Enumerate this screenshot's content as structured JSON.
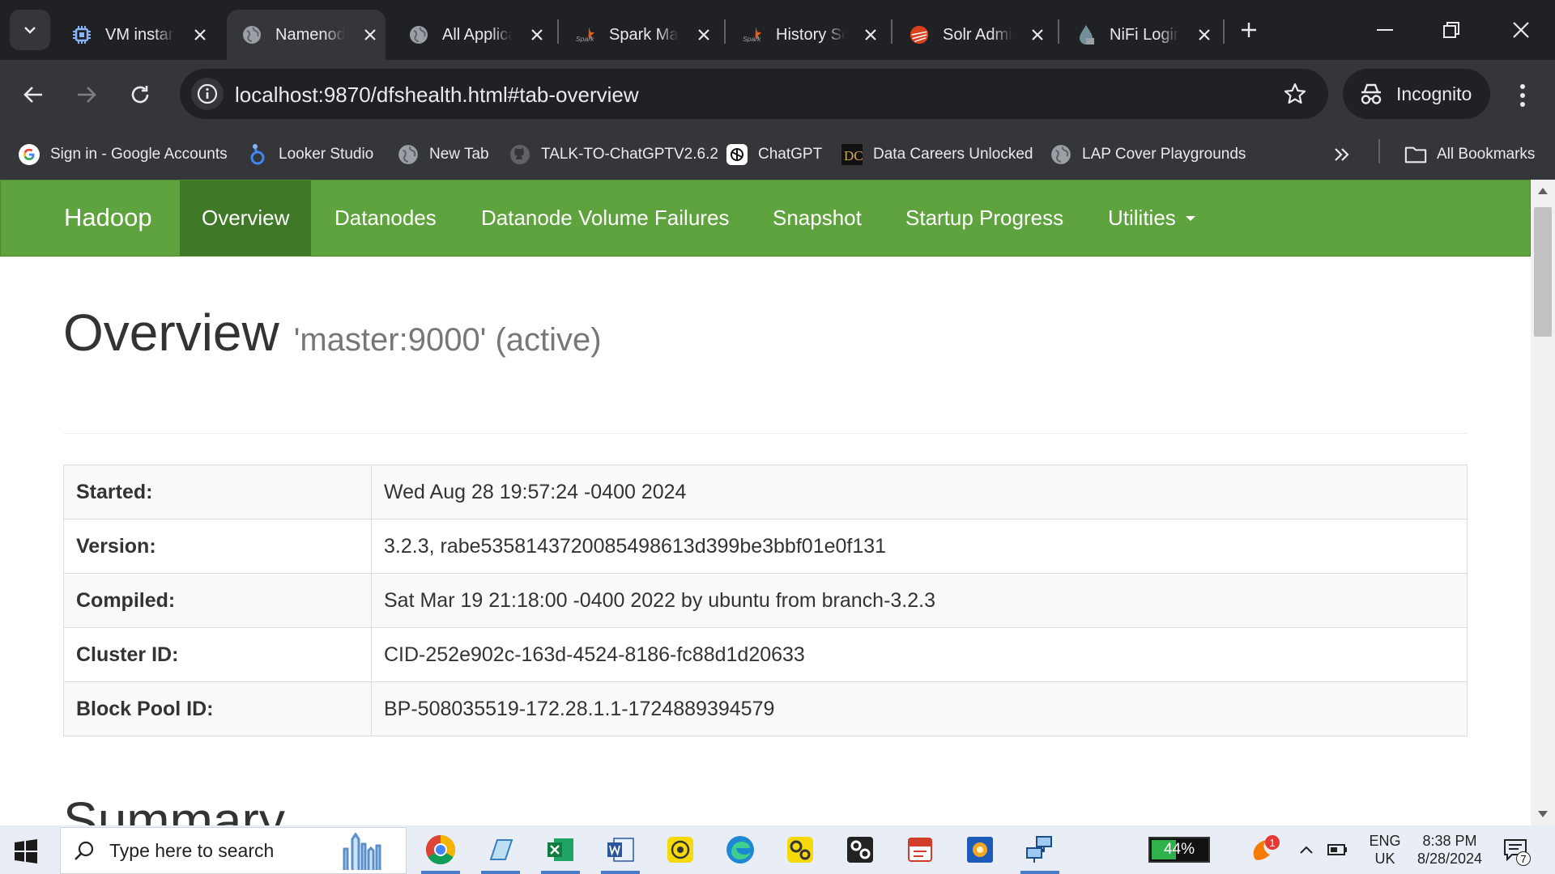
{
  "browser": {
    "tabs": [
      {
        "title": "VM instances",
        "icon": "cpu-chip-icon"
      },
      {
        "title": "Namenode information",
        "icon": "globe-icon"
      },
      {
        "title": "All Applications",
        "icon": "globe-icon"
      },
      {
        "title": "Spark Master",
        "icon": "spark-logo-icon"
      },
      {
        "title": "History Server",
        "icon": "spark-logo-icon"
      },
      {
        "title": "Solr Admin",
        "icon": "solr-logo-icon"
      },
      {
        "title": "NiFi Login",
        "icon": "nifi-drop-icon"
      }
    ],
    "url": "localhost:9870/dfshealth.html#tab-overview",
    "incognito_label": "Incognito",
    "bookmarks": [
      {
        "label": "Sign in - Google Accounts",
        "icon": "google-g-icon"
      },
      {
        "label": "Looker Studio",
        "icon": "looker-icon"
      },
      {
        "label": "New Tab",
        "icon": "globe-icon"
      },
      {
        "label": "TALK-TO-ChatGPTV2.6.2",
        "icon": "github-icon"
      },
      {
        "label": "ChatGPT",
        "icon": "chatgpt-icon"
      },
      {
        "label": "Data Careers Unlocked",
        "icon": "dc-logo-icon"
      },
      {
        "label": "LAP Cover Playgrounds",
        "icon": "globe-icon"
      }
    ],
    "all_bookmarks_label": "All Bookmarks"
  },
  "page": {
    "brand": "Hadoop",
    "nav": [
      {
        "label": "Overview",
        "active": true
      },
      {
        "label": "Datanodes"
      },
      {
        "label": "Datanode Volume Failures"
      },
      {
        "label": "Snapshot"
      },
      {
        "label": "Startup Progress"
      },
      {
        "label": "Utilities"
      }
    ],
    "overview_title": "Overview",
    "overview_subtitle": "'master:9000' (active)",
    "info_rows": [
      {
        "label": "Started:",
        "value": "Wed Aug 28 19:57:24 -0400 2024"
      },
      {
        "label": "Version:",
        "value": "3.2.3, rabe5358143720085498613d399be3bbf01e0f131"
      },
      {
        "label": "Compiled:",
        "value": "Sat Mar 19 21:18:00 -0400 2022 by ubuntu from branch-3.2.3"
      },
      {
        "label": "Cluster ID:",
        "value": "CID-252e902c-163d-4524-8186-fc88d1d20633"
      },
      {
        "label": "Block Pool ID:",
        "value": "BP-508035519-172.28.1.1-1724889394579"
      }
    ],
    "summary_title": "Summary"
  },
  "taskbar": {
    "search_placeholder": "Type here to search",
    "battery_percent": "44%",
    "battery_level": 0.44,
    "language_line1": "ENG",
    "language_line2": "UK",
    "time": "8:38 PM",
    "date": "8/28/2024",
    "notification_count": "1",
    "action_center_count": "7"
  },
  "colors": {
    "hadoop_green": "#5fa33e",
    "hadoop_green_active": "#3f7826",
    "chrome_dark": "#202124",
    "chrome_toolbar": "#35363a"
  }
}
